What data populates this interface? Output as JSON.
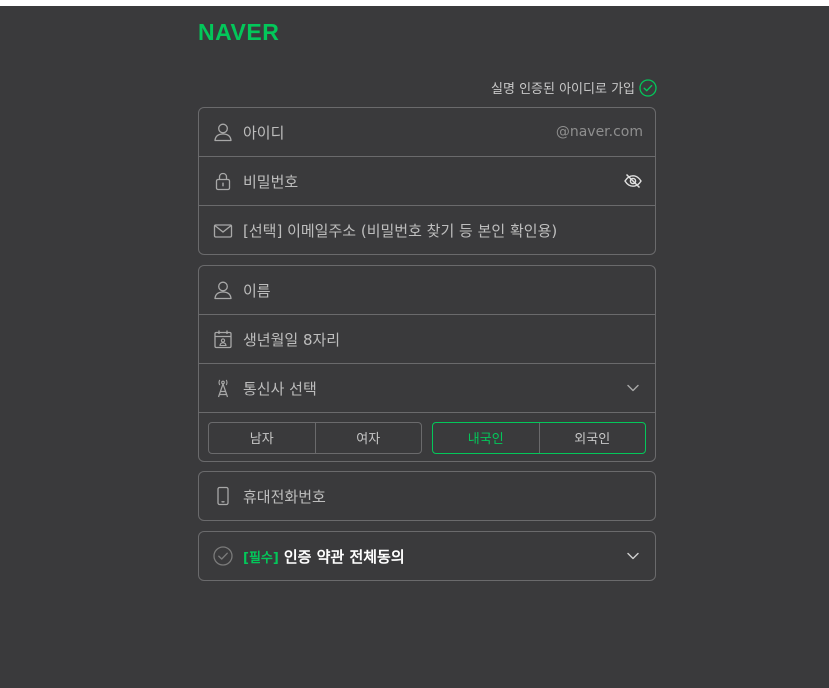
{
  "brand": {
    "logo_text": "NAVER",
    "color": "#03c75a"
  },
  "verified_link": {
    "label": "실명 인증된 아이디로 가입"
  },
  "account": {
    "id_placeholder": "아이디",
    "id_suffix": "@naver.com",
    "password_placeholder": "비밀번호",
    "email_placeholder": "[선택] 이메일주소 (비밀번호 찾기 등 본인 확인용)"
  },
  "identity": {
    "name_placeholder": "이름",
    "birth_placeholder": "생년월일 8자리",
    "carrier_placeholder": "통신사 선택",
    "gender": {
      "options": [
        "남자",
        "여자"
      ],
      "selected": ""
    },
    "nationality": {
      "options": [
        "내국인",
        "외국인"
      ],
      "selected": "내국인"
    }
  },
  "phone": {
    "placeholder": "휴대전화번호"
  },
  "terms": {
    "required_tag": "[필수]",
    "label": "인증 약관 전체동의"
  }
}
